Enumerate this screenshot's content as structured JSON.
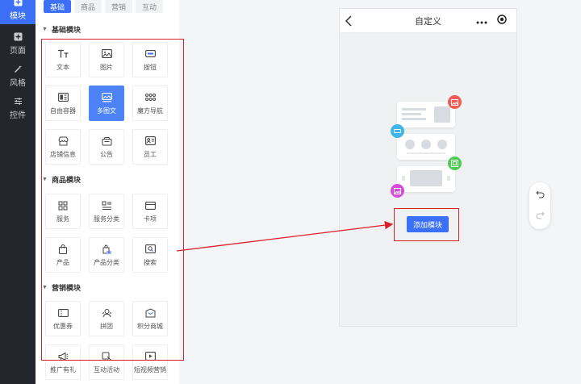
{
  "nav": {
    "items": [
      {
        "label": "模块",
        "icon": "plus-square-icon",
        "active": true
      },
      {
        "label": "页面",
        "icon": "plus-box-icon",
        "active": false
      },
      {
        "label": "风格",
        "icon": "magic-wand-icon",
        "active": false
      },
      {
        "label": "控件",
        "icon": "sliders-icon",
        "active": false
      }
    ]
  },
  "panel": {
    "tabs": [
      {
        "label": "基础",
        "active": true
      },
      {
        "label": "商品",
        "active": false
      },
      {
        "label": "营销",
        "active": false
      },
      {
        "label": "互动",
        "active": false
      }
    ],
    "sections": [
      {
        "title": "基础模块",
        "items": [
          {
            "label": "文本",
            "icon": "text-icon"
          },
          {
            "label": "图片",
            "icon": "image-icon"
          },
          {
            "label": "按钮",
            "icon": "button-icon"
          },
          {
            "label": "自由容器",
            "icon": "container-icon"
          },
          {
            "label": "多图文",
            "icon": "multi-image-text-icon",
            "selected": true
          },
          {
            "label": "魔方导航",
            "icon": "grid-dots-icon"
          },
          {
            "label": "店铺信息",
            "icon": "store-icon"
          },
          {
            "label": "公告",
            "icon": "notice-icon"
          },
          {
            "label": "员工",
            "icon": "staff-card-icon"
          }
        ]
      },
      {
        "title": "商品模块",
        "items": [
          {
            "label": "服务",
            "icon": "service-grid-icon"
          },
          {
            "label": "服务分类",
            "icon": "service-category-icon"
          },
          {
            "label": "卡项",
            "icon": "card-icon"
          },
          {
            "label": "产品",
            "icon": "bag-icon"
          },
          {
            "label": "产品分类",
            "icon": "bag-category-icon"
          },
          {
            "label": "搜索",
            "icon": "search-icon"
          }
        ]
      },
      {
        "title": "营销模块",
        "items": [
          {
            "label": "优惠券",
            "icon": "coupon-icon"
          },
          {
            "label": "拼团",
            "icon": "group-buy-icon"
          },
          {
            "label": "积分商城",
            "icon": "points-mall-icon"
          },
          {
            "label": "推广有礼",
            "icon": "megaphone-icon"
          },
          {
            "label": "互动活动",
            "icon": "interactive-icon"
          },
          {
            "label": "短视频营销",
            "icon": "video-icon"
          }
        ]
      }
    ]
  },
  "canvas": {
    "title": "自定义",
    "add_button": "添加模块"
  },
  "colors": {
    "accent": "#3a6ff6",
    "highlight": "#d9202a",
    "nav_bg": "#23262d"
  }
}
